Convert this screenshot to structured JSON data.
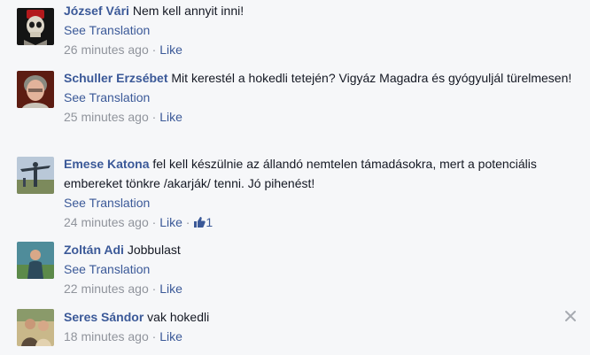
{
  "comments": [
    {
      "author": "József Vári",
      "text": "Nem kell annyit inni!",
      "translate": "See Translation",
      "time": "26 minutes ago",
      "sep": "·",
      "like": "Like"
    },
    {
      "author": "Schuller Erzsébet",
      "text": "Mit kerestél a hokedli tetején? Vigyáz Magadra és gyógyuljál türelmesen!",
      "translate": "See Translation",
      "time": "25 minutes ago",
      "sep": "·",
      "like": "Like"
    },
    {
      "author": "Emese Katona",
      "text": "fel kell készülnie az állandó nemtelen támadásokra, mert a potenciális embereket tönkre /akarják/ tenni. Jó pihenést!",
      "translate": "See Translation",
      "time": "24 minutes ago",
      "sep": "·",
      "like": "Like",
      "like_count": "1"
    },
    {
      "author": "Zoltán Adi",
      "text": "Jobbulast",
      "translate": "See Translation",
      "time": "22 minutes ago",
      "sep": "·",
      "like": "Like"
    },
    {
      "author": "Seres Sándor",
      "text": "vak hokedli",
      "time": "18 minutes ago",
      "sep": "·",
      "like": "Like"
    }
  ],
  "icons": {
    "thumb": "thumbs-up-icon",
    "close": "close-icon"
  },
  "colors": {
    "link": "#3b5998",
    "meta": "#90949c",
    "background": "#f6f7f9",
    "text": "#141823"
  }
}
